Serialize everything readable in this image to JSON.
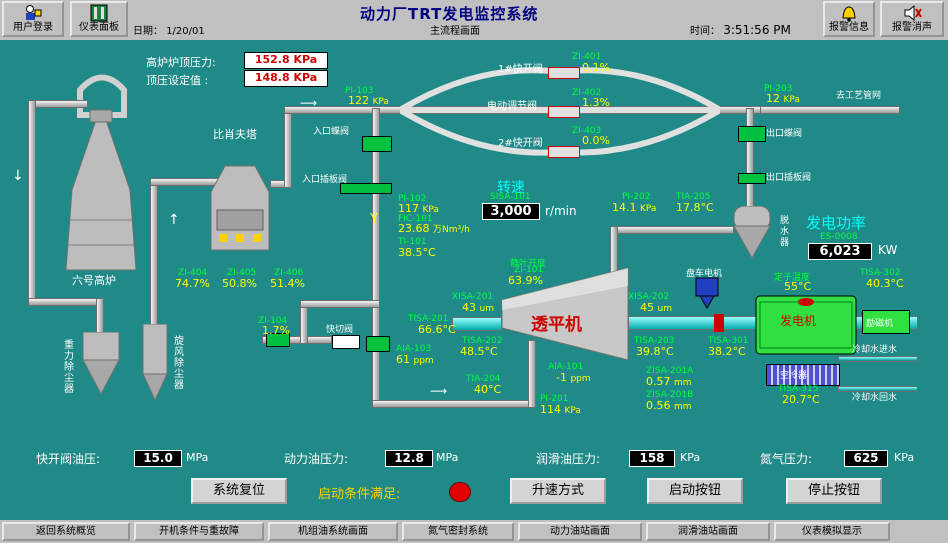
{
  "toolbar": {
    "login": "用户登录",
    "instruments": "仪表面板",
    "alarm_info": "报警信息",
    "alarm_clear": "报警消声"
  },
  "header": {
    "title": "动力厂TRT发电监控系统",
    "date_label": "日期：",
    "date": "1/20/01",
    "screen_name": "主流程画面",
    "time_label": "时间：",
    "time": "3:51:56 PM"
  },
  "top_pressure": {
    "label1": "高炉炉顶压力:",
    "value1": "152.8 KPa",
    "label2": "顶压设定值 :",
    "value2": "148.8 KPa"
  },
  "equipment": {
    "furnace": "六号高炉",
    "gravity_dust": "重力除尘器",
    "cyclone_dust": "旋风除尘器",
    "venturi": "比肖夫塔",
    "turbine": "透平机",
    "generator": "发电机",
    "dehydrator": "脱水器",
    "excitation": "励磁机",
    "inlet_butterfly": "入口蝶阀",
    "inlet_gate": "入口插板阀",
    "outlet_butterfly": "出口蝶阀",
    "outlet_gate": "出口插板阀",
    "quick_valve": "快切阀",
    "bypass1": "1#快开阀",
    "bypass_reg": "电动调节阀",
    "bypass2": "2#快开阀",
    "turning_motor": "盘车电机",
    "to_pipe": "去工艺管网",
    "cool_in": "冷却水进水",
    "cool_out": "冷却水回水",
    "cooler": "空冷器"
  },
  "points": {
    "pi103": {
      "tag": "PI-103",
      "val": "122",
      "unit": "KPa"
    },
    "pi203": {
      "tag": "PI-203",
      "val": "12",
      "unit": "KPa"
    },
    "zi401": {
      "tag": "ZI-401",
      "val": "0.1%"
    },
    "zi402": {
      "tag": "ZI-402",
      "val": "1.3%"
    },
    "zi403": {
      "tag": "ZI-403",
      "val": "0.0%"
    },
    "pi102": {
      "tag": "PI-102",
      "val": "117",
      "unit": "KPa"
    },
    "fic101": {
      "tag": "FIC-101",
      "val": "23.68",
      "unit": "万Nm³/h"
    },
    "ti101": {
      "tag": "TI-101",
      "val": "38.5°C"
    },
    "sisa101": {
      "label": "转速",
      "tag": "SISA-101",
      "val": "3,000",
      "unit": "r/min"
    },
    "pi202": {
      "tag": "PI-202",
      "val": "14.1",
      "unit": "KPa"
    },
    "tia205": {
      "tag": "TIA-205",
      "val": "17.8°C"
    },
    "power": {
      "label": "发电功率",
      "tag": "ES-0008",
      "val": "6,023",
      "unit": "KW"
    },
    "zi404": {
      "tag": "ZI-404",
      "val": "74.7%"
    },
    "zi405": {
      "tag": "ZI-405",
      "val": "50.8%"
    },
    "zi406": {
      "tag": "ZI-406",
      "val": "51.4%"
    },
    "zi101": {
      "label": "静叶开度",
      "tag": "ZI-101",
      "val": "63.9%"
    },
    "xisa201": {
      "tag": "XISA-201",
      "val": "43",
      "unit": "um"
    },
    "xisa202": {
      "tag": "XISA-202",
      "val": "45",
      "unit": "um"
    },
    "stator": {
      "label": "定子温度",
      "val": "55°C"
    },
    "tisa302": {
      "tag": "TISA-302",
      "val": "40.3°C"
    },
    "zi104": {
      "tag": "ZI-104",
      "val": "1.7%"
    },
    "tisa201": {
      "tag": "TISA-201",
      "val": "66.6°C"
    },
    "tisa202": {
      "tag": "TISA-202",
      "val": "48.5°C"
    },
    "aia103": {
      "tag": "AIA-103",
      "val": "61",
      "unit": "ppm"
    },
    "tisa203": {
      "tag": "TISA-203",
      "val": "39.8°C"
    },
    "tisa301": {
      "tag": "TISA-301",
      "val": "38.2°C"
    },
    "tia204": {
      "tag": "TIA-204",
      "val": "40°C"
    },
    "aia101": {
      "tag": "AIA-101",
      "val": "-1",
      "unit": "ppm"
    },
    "zisa201a": {
      "tag": "ZISA-201A",
      "val": "0.57",
      "unit": "mm"
    },
    "zisa201b": {
      "tag": "ZISA-201B",
      "val": "0.56",
      "unit": "mm"
    },
    "tisa315": {
      "tag": "TISA-315",
      "val": "20.7°C"
    },
    "pi201": {
      "tag": "PI-201",
      "val": "114",
      "unit": "KPa"
    }
  },
  "bottom_readouts": {
    "quick_oil_label": "快开阀油压:",
    "quick_oil_val": "15.0",
    "power_oil_label": "动力油压力:",
    "power_oil_val": "12.8",
    "lube_oil_label": "润滑油压力:",
    "lube_oil_val": "158",
    "n2_label": "氮气压力:",
    "n2_val": "625",
    "unit_mpa": "MPa",
    "unit_kpa": "KPa"
  },
  "controls": {
    "reset": "系统复位",
    "start_cond": "启动条件满足:",
    "speed_mode": "升速方式",
    "start": "启动按钮",
    "stop": "停止按钮"
  },
  "nav": [
    "返回系统概览",
    "开机条件与重故障",
    "机组油系统画面",
    "氮气密封系统",
    "动力油站画面",
    "润滑油站画面",
    "仪表模拟显示"
  ],
  "colors": {
    "background": "#1f8a87",
    "alarm_indicator": "#e00000",
    "value_text": "#ffff00",
    "tag_text": "#00ff40"
  }
}
